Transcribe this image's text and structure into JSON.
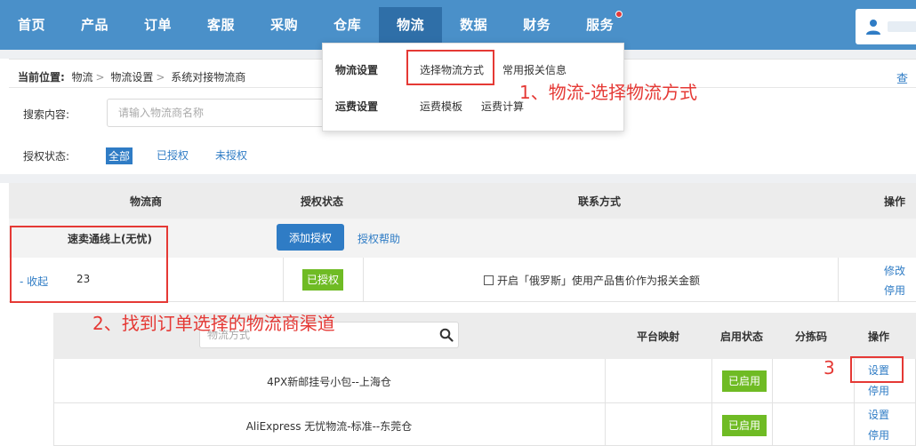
{
  "nav": {
    "tabs": [
      "首页",
      "产品",
      "订单",
      "客服",
      "采购",
      "仓库",
      "物流",
      "数据",
      "财务",
      "服务"
    ],
    "active_index": 6
  },
  "breadcrumb": {
    "label": "当前位置:",
    "items": [
      "物流",
      "物流设置",
      "系统对接物流商"
    ],
    "view_link": "查"
  },
  "search": {
    "label": "搜索内容:",
    "placeholder": "请输入物流商名称"
  },
  "auth_filter": {
    "label": "授权状态:",
    "options": [
      "全部",
      "已授权",
      "未授权"
    ],
    "selected": "全部"
  },
  "dropdown": {
    "logistics_settings": "物流设置",
    "choose_method": "选择物流方式",
    "customs_info": "常用报关信息",
    "shipping_settings": "运费设置",
    "shipping_template": "运费模板",
    "shipping_calc": "运费计算"
  },
  "table": {
    "headers": {
      "provider": "物流商",
      "auth_status": "授权状态",
      "contact": "联系方式",
      "ops": "操作"
    },
    "provider_name": "速卖通线上(无忧)",
    "add_auth_button": "添加授权",
    "auth_help": "授权帮助",
    "collapse": "- 收起",
    "count": "23",
    "auth_badge": "已授权",
    "checkbox_label": "开启「俄罗斯」使用产品售价作为报关金额",
    "edit": "修改",
    "disable": "停用"
  },
  "subtable": {
    "search_placeholder": "物流方式",
    "headers": {
      "mapping": "平台映射",
      "enabled": "启用状态",
      "sort_code": "分拣码",
      "ops": "操作"
    },
    "rows": [
      {
        "name": "4PX新邮挂号小包--上海仓",
        "status": "已启用",
        "settings": "设置",
        "disable": "停用"
      },
      {
        "name": "AliExpress 无忧物流-标准--东莞仓",
        "status": "已启用",
        "settings": "设置",
        "disable": "停用"
      }
    ]
  },
  "annotations": {
    "step1": "1、物流-选择物流方式",
    "step2": "2、找到订单选择的物流商渠道",
    "step3": "3"
  },
  "colors": {
    "nav_bg": "#4a90c9",
    "nav_active": "#2f6fa8",
    "link": "#2f7cc5",
    "badge_green": "#6fbb24",
    "annotation_red": "#e53935"
  }
}
